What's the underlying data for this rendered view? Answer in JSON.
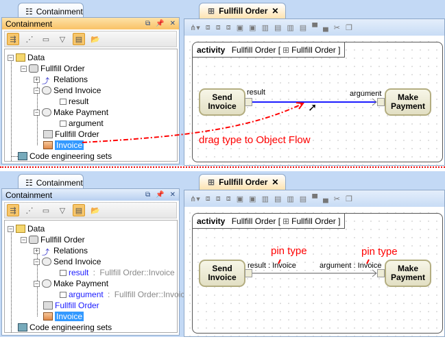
{
  "containment_tab": "Containment",
  "panel_title": "Containment",
  "diagram_tab": "Fullfill Order",
  "frame": {
    "kind": "activity",
    "name": "Fullfill Order [",
    "ref": "Fullfill Order ]"
  },
  "tree": {
    "data": "Data",
    "fullfill_order": "Fullfill Order",
    "relations": "Relations",
    "send_invoice": "Send Invoice",
    "result": "result",
    "make_payment": "Make Payment",
    "argument": "argument",
    "fullfill_order_diagram": "Fullfill Order",
    "invoice": "Invoice",
    "code_sets": "Code engineering sets",
    "type_suffix_sep": " : ",
    "type_suffix": "Fullfill Order::Invoice"
  },
  "diagram": {
    "send": "Send\nInvoice",
    "make": "Make\nPayment",
    "result": "result",
    "argument": "argument",
    "result_typed": "result : Invoice",
    "argument_typed": "argument : Invoice"
  },
  "annotations": {
    "drag": "drag type to Object Flow",
    "pin_type": "pin type"
  },
  "colors": {
    "annotation": "#ff0000",
    "selection": "#3399ff",
    "flow_selected": "#1a1aff"
  }
}
